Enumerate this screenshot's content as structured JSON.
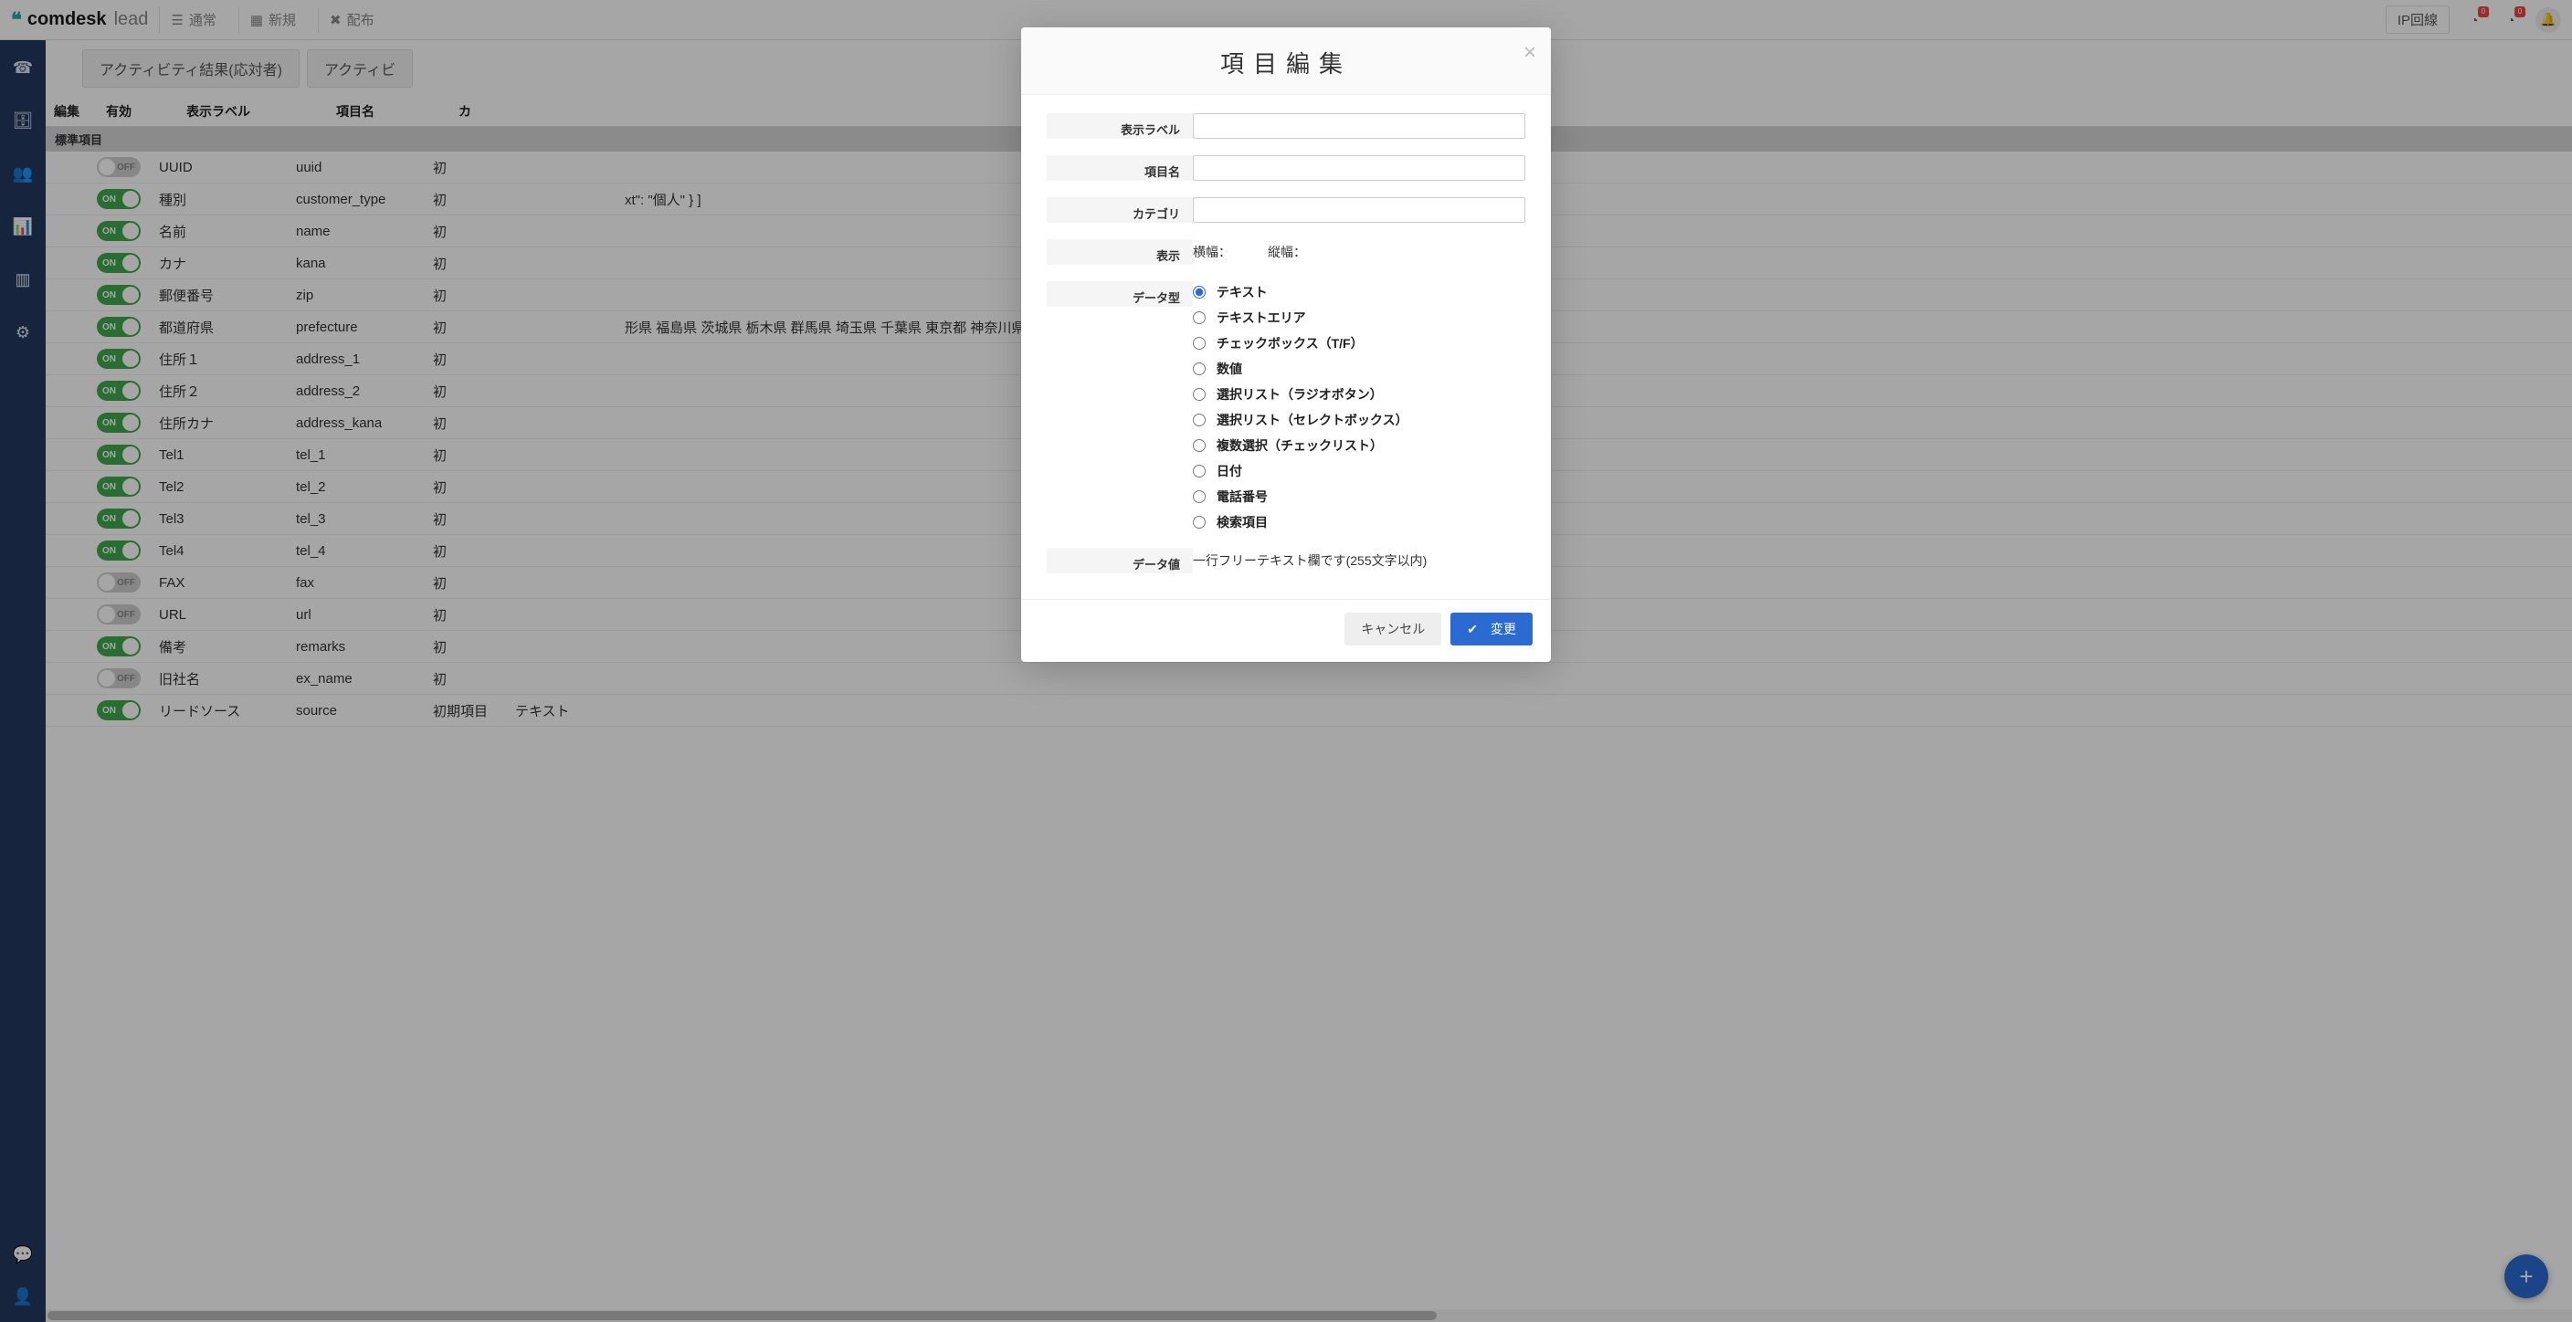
{
  "topbar": {
    "brand_main": "comdesk",
    "brand_sub": "lead",
    "buttons": {
      "normal": "通常",
      "new": "新規",
      "distribute": "配布"
    },
    "ip_line": "IP回線",
    "badge1": "0",
    "badge2": "0"
  },
  "tabs": {
    "tab1": "アクティビティ結果(応対者)",
    "tab2": "アクティビ"
  },
  "table": {
    "headers": {
      "edit": "編集",
      "enable": "有効",
      "label": "表示ラベル",
      "name": "項目名",
      "category": "カ",
      "type": ""
    },
    "group_label": "標準項目",
    "rows": [
      {
        "enabled": false,
        "enable_text": "OFF",
        "label": "UUID",
        "name": "uuid",
        "cat": "初",
        "extra": ""
      },
      {
        "enabled": true,
        "enable_text": "ON",
        "label": "種別",
        "name": "customer_type",
        "cat": "初",
        "extra": "xt\": \"個人\" } ]"
      },
      {
        "enabled": true,
        "enable_text": "ON",
        "label": "名前",
        "name": "name",
        "cat": "初",
        "extra": ""
      },
      {
        "enabled": true,
        "enable_text": "ON",
        "label": "カナ",
        "name": "kana",
        "cat": "初",
        "extra": ""
      },
      {
        "enabled": true,
        "enable_text": "ON",
        "label": "郵便番号",
        "name": "zip",
        "cat": "初",
        "extra": ""
      },
      {
        "enabled": true,
        "enable_text": "ON",
        "label": "都道府県",
        "name": "prefecture",
        "cat": "初",
        "extra": "形県 福島県 茨城県 栃木県 群馬県 埼玉県 千葉県 東京都 神奈川県 新"
      },
      {
        "enabled": true,
        "enable_text": "ON",
        "label": "住所１",
        "name": "address_1",
        "cat": "初",
        "extra": ""
      },
      {
        "enabled": true,
        "enable_text": "ON",
        "label": "住所２",
        "name": "address_2",
        "cat": "初",
        "extra": ""
      },
      {
        "enabled": true,
        "enable_text": "ON",
        "label": "住所カナ",
        "name": "address_kana",
        "cat": "初",
        "extra": ""
      },
      {
        "enabled": true,
        "enable_text": "ON",
        "label": "Tel1",
        "name": "tel_1",
        "cat": "初",
        "extra": ""
      },
      {
        "enabled": true,
        "enable_text": "ON",
        "label": "Tel2",
        "name": "tel_2",
        "cat": "初",
        "extra": ""
      },
      {
        "enabled": true,
        "enable_text": "ON",
        "label": "Tel3",
        "name": "tel_3",
        "cat": "初",
        "extra": ""
      },
      {
        "enabled": true,
        "enable_text": "ON",
        "label": "Tel4",
        "name": "tel_4",
        "cat": "初",
        "extra": ""
      },
      {
        "enabled": false,
        "enable_text": "OFF",
        "label": "FAX",
        "name": "fax",
        "cat": "初",
        "extra": ""
      },
      {
        "enabled": false,
        "enable_text": "OFF",
        "label": "URL",
        "name": "url",
        "cat": "初",
        "extra": ""
      },
      {
        "enabled": true,
        "enable_text": "ON",
        "label": "備考",
        "name": "remarks",
        "cat": "初",
        "extra": ""
      },
      {
        "enabled": false,
        "enable_text": "OFF",
        "label": "旧社名",
        "name": "ex_name",
        "cat": "初",
        "extra": ""
      },
      {
        "enabled": true,
        "enable_text": "ON",
        "label": "リードソース",
        "name": "source",
        "cat": "初期項目",
        "type": "テキスト",
        "extra": ""
      }
    ]
  },
  "modal": {
    "title": "項目編集",
    "labels": {
      "display_label": "表示ラベル",
      "item_name": "項目名",
      "category": "カテゴリ",
      "display": "表示",
      "width": "横幅：",
      "height": "縦幅：",
      "data_type": "データ型",
      "data_value": "データ値"
    },
    "data_types": [
      "テキスト",
      "テキストエリア",
      "チェックボックス（T/F）",
      "数値",
      "選択リスト（ラジオボタン）",
      "選択リスト（セレクトボックス）",
      "複数選択（チェックリスト）",
      "日付",
      "電話番号",
      "検索項目"
    ],
    "data_value_desc": "一行フリーテキスト欄です(255文字以内)",
    "buttons": {
      "cancel": "キャンセル",
      "submit": "変更"
    }
  }
}
